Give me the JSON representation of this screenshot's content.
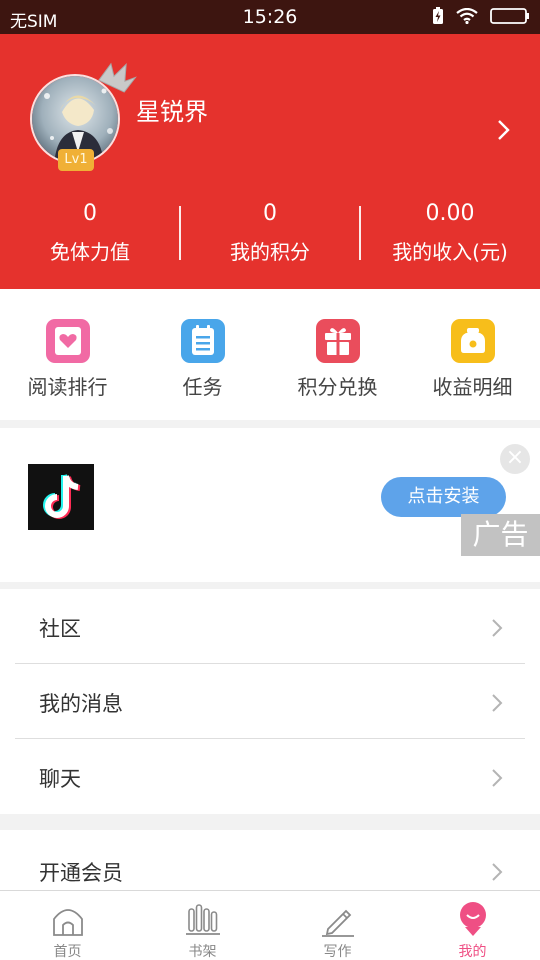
{
  "status_bar": {
    "carrier": "无SIM",
    "time": "15:26",
    "icons": [
      "battery-charging-icon",
      "wifi-icon",
      "battery-icon"
    ]
  },
  "profile": {
    "username": "星锐界",
    "level": "Lv1",
    "stats": [
      {
        "value": "0",
        "label": "免体力值"
      },
      {
        "value": "0",
        "label": "我的积分"
      },
      {
        "value": "0.00",
        "label": "我的收入(元)"
      }
    ],
    "header_color": "#e5322d"
  },
  "quick_actions": [
    {
      "label": "阅读排行",
      "icon": "ranking-icon",
      "color": "#f16aa4"
    },
    {
      "label": "任务",
      "icon": "task-list-icon",
      "color": "#49a6ea"
    },
    {
      "label": "积分兑换",
      "icon": "gift-icon",
      "color": "#ea4d5c"
    },
    {
      "label": "收益明细",
      "icon": "wallet-icon",
      "color": "#f7be1b"
    }
  ],
  "ad": {
    "install_label": "点击安装",
    "tag": "广告",
    "close_symbol": "×",
    "logo_icon": "tiktok-logo-icon"
  },
  "menu_primary": [
    {
      "label": "社区"
    },
    {
      "label": "我的消息"
    },
    {
      "label": "聊天"
    }
  ],
  "menu_secondary": [
    {
      "label": "开通会员"
    }
  ],
  "bottom_nav": [
    {
      "label": "首页",
      "icon": "home-icon",
      "active": false
    },
    {
      "label": "书架",
      "icon": "bookshelf-icon",
      "active": false
    },
    {
      "label": "写作",
      "icon": "pen-icon",
      "active": false
    },
    {
      "label": "我的",
      "icon": "profile-icon",
      "active": true
    }
  ],
  "colors": {
    "accent_pink": "#ef4f84",
    "install_blue": "#5ea3ea",
    "level_badge": "#f0b036"
  }
}
